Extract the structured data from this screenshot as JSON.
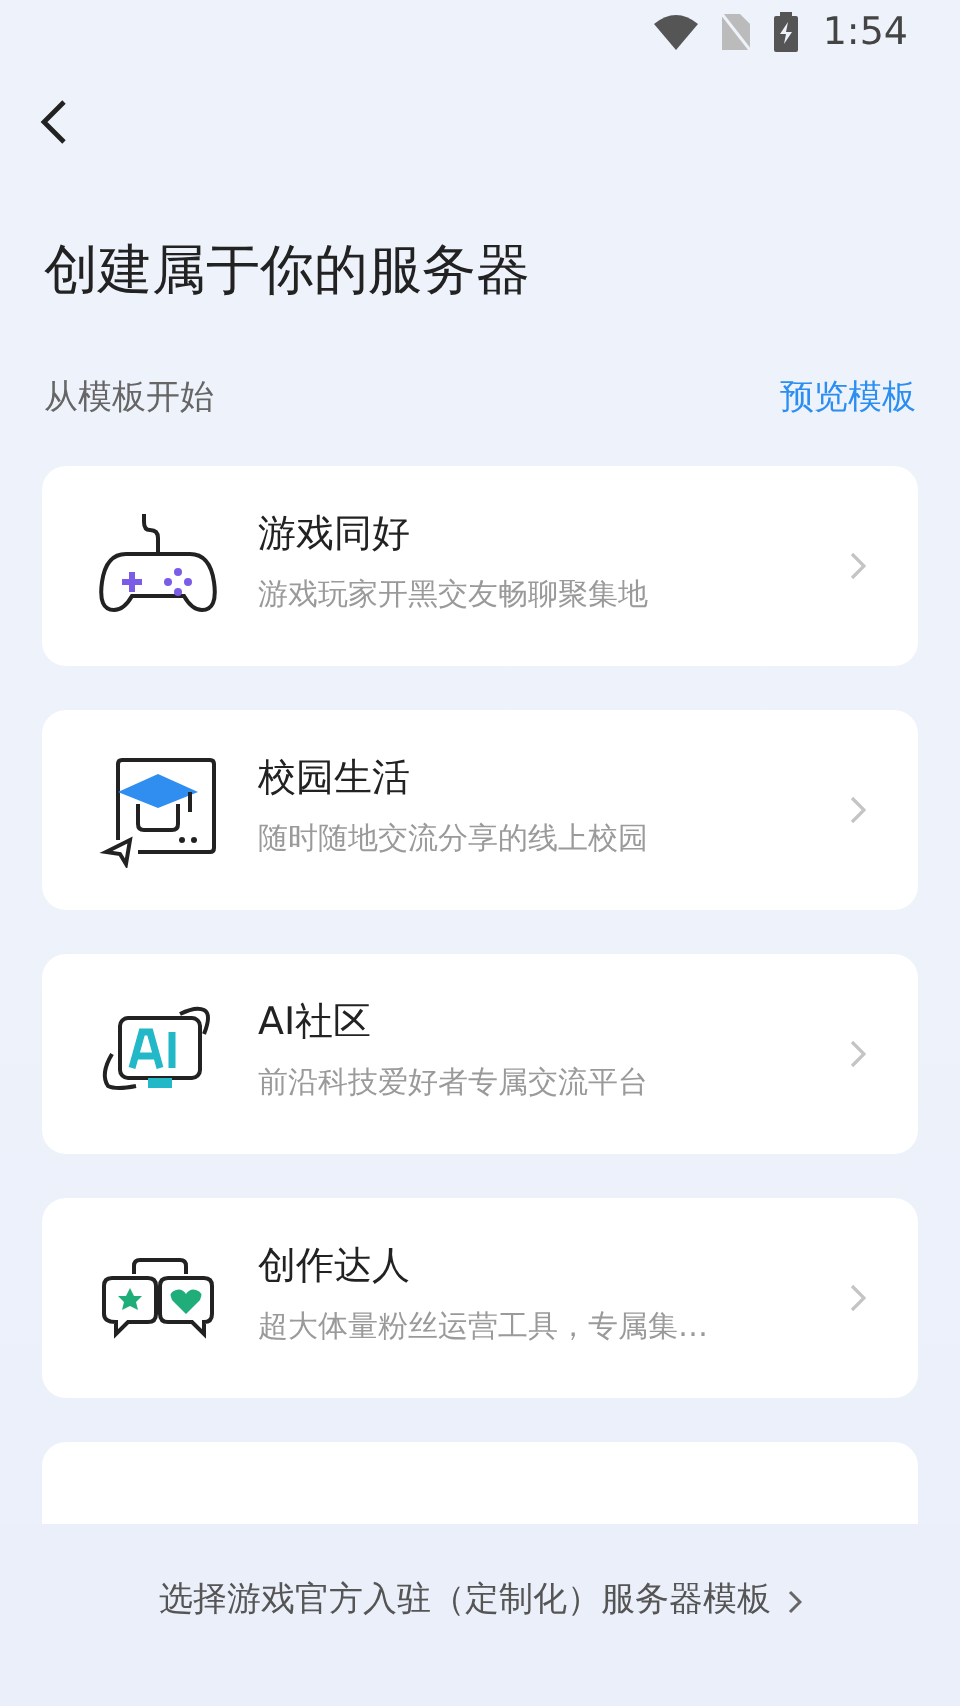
{
  "status_bar": {
    "time": "1:54"
  },
  "header": {
    "title": "创建属于你的服务器"
  },
  "section": {
    "label": "从模板开始",
    "link": "预览模板"
  },
  "templates": [
    {
      "kind": "gamepad",
      "title": "游戏同好",
      "subtitle": "游戏玩家开黑交友畅聊聚集地"
    },
    {
      "kind": "campus",
      "title": "校园生活",
      "subtitle": "随时随地交流分享的线上校园"
    },
    {
      "kind": "ai",
      "title": "AI社区",
      "subtitle": "前沿科技爱好者专属交流平台"
    },
    {
      "kind": "creator",
      "title": "创作达人",
      "subtitle": "超大体量粉丝运营工具，专属集…"
    },
    {
      "kind": "partial"
    }
  ],
  "footer": {
    "link": "选择游戏官方入驻（定制化）服务器模板"
  }
}
